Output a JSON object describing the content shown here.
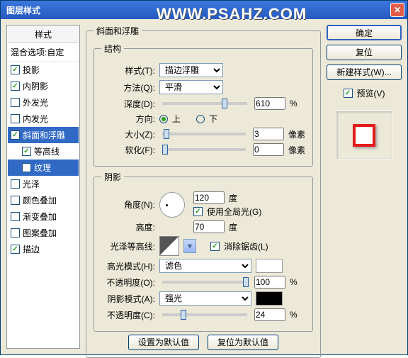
{
  "window": {
    "title": "图层样式",
    "watermark": "WWW.PSAHZ.COM"
  },
  "left": {
    "header": "样式",
    "blend": "混合选项:自定",
    "items": [
      {
        "label": "投影",
        "checked": true,
        "sel": false,
        "sub": false
      },
      {
        "label": "内阴影",
        "checked": true,
        "sel": false,
        "sub": false
      },
      {
        "label": "外发光",
        "checked": false,
        "sel": false,
        "sub": false
      },
      {
        "label": "内发光",
        "checked": false,
        "sel": false,
        "sub": false
      },
      {
        "label": "斜面和浮雕",
        "checked": true,
        "sel": true,
        "sub": false
      },
      {
        "label": "等高线",
        "checked": true,
        "sel": false,
        "sub": true
      },
      {
        "label": "纹理",
        "checked": false,
        "sel": true,
        "sub": true
      },
      {
        "label": "光泽",
        "checked": false,
        "sel": false,
        "sub": false
      },
      {
        "label": "颜色叠加",
        "checked": false,
        "sel": false,
        "sub": false
      },
      {
        "label": "渐变叠加",
        "checked": false,
        "sel": false,
        "sub": false
      },
      {
        "label": "图案叠加",
        "checked": false,
        "sel": false,
        "sub": false
      },
      {
        "label": "描边",
        "checked": true,
        "sel": false,
        "sub": false
      }
    ]
  },
  "group": {
    "title": "斜面和浮雕"
  },
  "struct": {
    "title": "结构",
    "style_lbl": "样式(T):",
    "style_val": "描边浮雕",
    "tech_lbl": "方法(Q):",
    "tech_val": "平滑",
    "depth_lbl": "深度(D):",
    "depth_val": "610",
    "depth_unit": "%",
    "dir_lbl": "方向:",
    "up": "上",
    "down": "下",
    "size_lbl": "大小(Z):",
    "size_val": "3",
    "size_unit": "像素",
    "soften_lbl": "软化(F):",
    "soften_val": "0",
    "soften_unit": "像素"
  },
  "shade": {
    "title": "阴影",
    "angle_lbl": "角度(N):",
    "angle_val": "120",
    "deg": "度",
    "global_lbl": "使用全局光(G)",
    "alt_lbl": "高度:",
    "alt_val": "70",
    "gloss_lbl": "光泽等高线:",
    "anti_lbl": "消除锯齿(L)",
    "hmode_lbl": "高光模式(H):",
    "hmode_val": "滤色",
    "hop_lbl": "不透明度(O):",
    "hop_val": "100",
    "pct": "%",
    "smode_lbl": "阴影模式(A):",
    "smode_val": "强光",
    "sop_lbl": "不透明度(C):",
    "sop_val": "24"
  },
  "bottom": {
    "def": "设置为默认值",
    "reset": "复位为默认值"
  },
  "right": {
    "ok": "确定",
    "cancel": "复位",
    "newstyle": "新建样式(W)...",
    "preview": "预览(V)"
  }
}
